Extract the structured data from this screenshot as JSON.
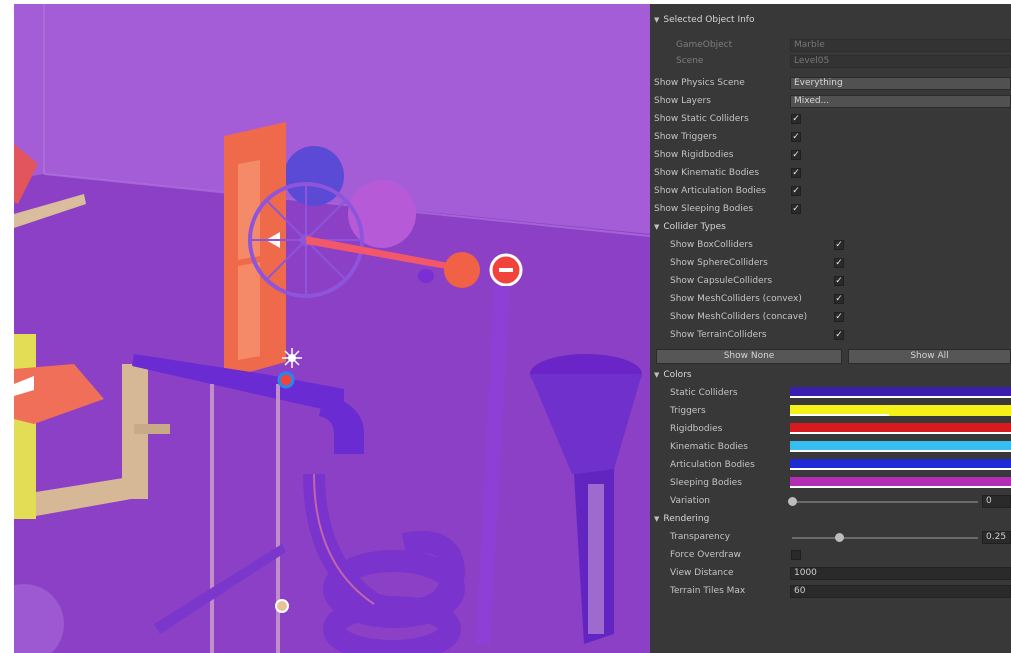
{
  "selected_object_info": {
    "header": "Selected Object Info",
    "gameobject_label": "GameObject",
    "gameobject_value": "Marble",
    "scene_label": "Scene",
    "scene_value": "Level05"
  },
  "show_physics_scene": {
    "label": "Show Physics Scene",
    "value": "Everything"
  },
  "show_layers": {
    "label": "Show Layers",
    "value": "Mixed..."
  },
  "toggles": [
    {
      "label": "Show Static Colliders",
      "checked": true
    },
    {
      "label": "Show Triggers",
      "checked": true
    },
    {
      "label": "Show Rigidbodies",
      "checked": true
    },
    {
      "label": "Show Kinematic Bodies",
      "checked": true
    },
    {
      "label": "Show Articulation Bodies",
      "checked": true
    },
    {
      "label": "Show Sleeping Bodies",
      "checked": true
    }
  ],
  "collider_types": {
    "header": "Collider Types",
    "items": [
      {
        "label": "Show BoxColliders",
        "checked": true
      },
      {
        "label": "Show SphereColliders",
        "checked": true
      },
      {
        "label": "Show CapsuleColliders",
        "checked": true
      },
      {
        "label": "Show MeshColliders (convex)",
        "checked": true
      },
      {
        "label": "Show MeshColliders (concave)",
        "checked": true
      },
      {
        "label": "Show TerrainColliders",
        "checked": true
      }
    ],
    "show_none_label": "Show None",
    "show_all_label": "Show All"
  },
  "colors": {
    "header": "Colors",
    "items": [
      {
        "label": "Static Colliders",
        "color": "#3a1fae",
        "alpha": 1.0
      },
      {
        "label": "Triggers",
        "color": "#f6f019",
        "alpha": 0.45
      },
      {
        "label": "Rigidbodies",
        "color": "#d81a1e",
        "alpha": 1.0
      },
      {
        "label": "Kinematic Bodies",
        "color": "#38bdf0",
        "alpha": 1.0
      },
      {
        "label": "Articulation Bodies",
        "color": "#1d2ad6",
        "alpha": 1.0
      },
      {
        "label": "Sleeping Bodies",
        "color": "#b22cb6",
        "alpha": 1.0
      }
    ],
    "variation_label": "Variation",
    "variation_value": "0"
  },
  "rendering": {
    "header": "Rendering",
    "transparency_label": "Transparency",
    "transparency_value": "0.25",
    "force_overdraw_label": "Force Overdraw",
    "force_overdraw_checked": false,
    "view_distance_label": "View Distance",
    "view_distance_value": "1000",
    "terrain_tiles_label": "Terrain Tiles Max",
    "terrain_tiles_value": "60"
  },
  "scene_colors": {
    "background": "#9a4fd0",
    "floor": "#8a3ec8",
    "wall": "#a05bd4",
    "orange_obstacle": "#ee6a4a",
    "track": "#6c2bd0",
    "sand_frame": "#d6b796",
    "yellow_frame": "#e6e04a"
  }
}
